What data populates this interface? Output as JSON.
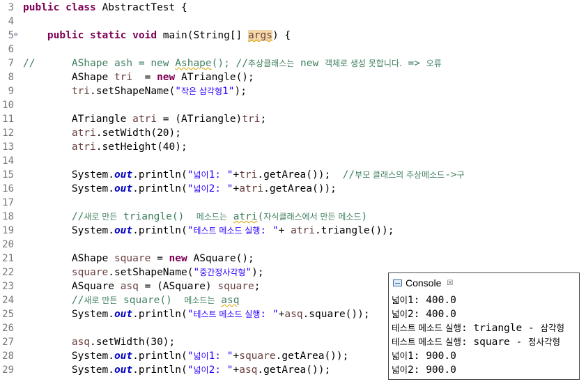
{
  "editor": {
    "lines": [
      {
        "n": "3",
        "fold": "",
        "html": "<span class='kw'>public class</span> AbstractTest {"
      },
      {
        "n": "4",
        "fold": "",
        "html": ""
      },
      {
        "n": "5",
        "fold": "⊖",
        "html": "    <span class='kw'>public static void</span> main(String[] <span class='var hl sq'>args</span>) {"
      },
      {
        "n": "6",
        "fold": "",
        "html": ""
      },
      {
        "n": "7",
        "fold": "",
        "html": "<span class='cmt'>//      AShape ash = new <span class='sq'>Ashape</span>(); //<span class='kr'>추상클래스는</span> new <span class='kr'>객체로 생성 못합니다.</span> => <span class='kr'>오류</span></span>"
      },
      {
        "n": "8",
        "fold": "",
        "html": "        AShape <span class='var'>tri</span>  = <span class='kw'>new</span> ATriangle();"
      },
      {
        "n": "9",
        "fold": "",
        "html": "        <span class='var'>tri</span>.setShapeName(<span class='str'>\"<span class='kr'>작은 삼각형</span>1\"</span>);"
      },
      {
        "n": "10",
        "fold": "",
        "html": ""
      },
      {
        "n": "11",
        "fold": "",
        "html": "        ATriangle <span class='var'>atri</span> = (ATriangle)<span class='var'>tri</span>;"
      },
      {
        "n": "12",
        "fold": "",
        "html": "        <span class='var'>atri</span>.setWidth(20);"
      },
      {
        "n": "13",
        "fold": "",
        "html": "        <span class='var'>atri</span>.setHeight(40);"
      },
      {
        "n": "14",
        "fold": "",
        "html": ""
      },
      {
        "n": "15",
        "fold": "",
        "html": "        System.<span class='fld'>out</span>.println(<span class='str'>\"<span class='kr'>넓이</span>1: \"</span>+<span class='var'>tri</span>.getArea());  <span class='cmt'>//<span class='kr'>부모 클래스의 추상메소드</span>-><span class='kr'>구</span></span>"
      },
      {
        "n": "16",
        "fold": "",
        "html": "        System.<span class='fld'>out</span>.println(<span class='str'>\"<span class='kr'>넓이</span>2: \"</span>+<span class='var'>atri</span>.getArea());"
      },
      {
        "n": "17",
        "fold": "",
        "html": ""
      },
      {
        "n": "18",
        "fold": "",
        "html": "        <span class='cmt'>//<span class='kr'>새로 만든</span> triangle()  <span class='kr'>메소드는</span> <span class='sq'>atri</span>(<span class='kr'>자식클래스에서 만든 메소드</span>)</span>"
      },
      {
        "n": "19",
        "fold": "",
        "html": "        System.<span class='fld'>out</span>.println(<span class='str'>\"<span class='kr'>테스트 메소드 실행</span>: \"</span>+ <span class='var'>atri</span>.triangle());"
      },
      {
        "n": "20",
        "fold": "",
        "html": ""
      },
      {
        "n": "21",
        "fold": "",
        "html": "        AShape <span class='var'>square</span> = <span class='kw'>new</span> ASquare();"
      },
      {
        "n": "22",
        "fold": "",
        "html": "        <span class='var'>square</span>.setShapeName(<span class='str'>\"<span class='kr'>중간정사각형</span>\"</span>);"
      },
      {
        "n": "23",
        "fold": "",
        "html": "        ASquare <span class='var'>asq</span> = (ASquare) <span class='var'>square</span>;"
      },
      {
        "n": "24",
        "fold": "",
        "html": "        <span class='cmt'>//<span class='kr'>새로 만든</span> square()  <span class='kr'>메소드는</span> <span class='sq'>asq</span></span>"
      },
      {
        "n": "25",
        "fold": "",
        "html": "        System.<span class='fld'>out</span>.println(<span class='str'>\"<span class='kr'>테스트 메소드 실행</span>: \"</span>+<span class='var'>asq</span>.square());"
      },
      {
        "n": "26",
        "fold": "",
        "html": ""
      },
      {
        "n": "27",
        "fold": "",
        "html": "        <span class='var'>asq</span>.setWidth(30);"
      },
      {
        "n": "28",
        "fold": "",
        "html": "        System.<span class='fld'>out</span>.println(<span class='str'>\"<span class='kr'>넓이</span>1: \"</span>+<span class='var'>square</span>.getArea());"
      },
      {
        "n": "29",
        "fold": "",
        "html": "        System.<span class='fld'>out</span>.println(<span class='str'>\"<span class='kr'>넓이</span>2: \"</span>+<span class='var'>asq</span>.getArea());"
      }
    ]
  },
  "console": {
    "title": "Console",
    "close_glyph": "☒",
    "icon": "console-icon",
    "output": [
      "<span class='kr'>넓이</span>1: 400.0",
      "<span class='kr'>넓이</span>2: 400.0",
      "<span class='kr'>테스트 메소드 실행</span>: triangle - <span class='kr'>삼각형</span>",
      "<span class='kr'>테스트 메소드 실행</span>: square - <span class='kr'>정사각형</span>",
      "<span class='kr'>넓이</span>1: 900.0",
      "<span class='kr'>넓이</span>2: 900.0"
    ]
  }
}
